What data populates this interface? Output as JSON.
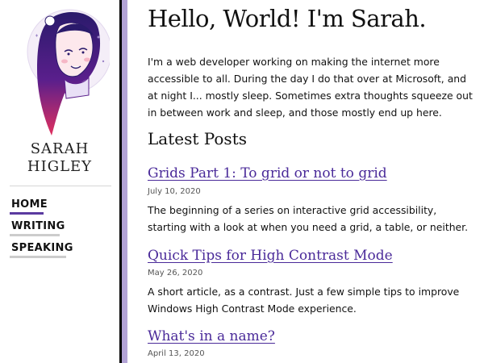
{
  "sidebar": {
    "name_line1": "SARAH",
    "name_line2": "HIGLEY",
    "nav": [
      {
        "label": "HOME",
        "active": true
      },
      {
        "label": "WRITING",
        "active": false
      },
      {
        "label": "SPEAKING",
        "active": false
      }
    ]
  },
  "main": {
    "heading": "Hello, World! I'm Sarah.",
    "intro": "I'm a web developer working on making the internet more accessible to all. During the day I do that over at Microsoft, and at night I... mostly sleep. Sometimes extra thoughts squeeze out in between work and sleep, and those mostly end up here.",
    "latest_heading": "Latest Posts",
    "posts": [
      {
        "title": "Grids Part 1: To grid or not to grid",
        "date": "July 10, 2020",
        "excerpt": "The beginning of a series on interactive grid accessibility, starting with a look at when you need a grid, a table, or neither."
      },
      {
        "title": "Quick Tips for High Contrast Mode",
        "date": "May 26, 2020",
        "excerpt": "A short article, as a contrast. Just a few simple tips to improve Windows High Contrast Mode experience."
      },
      {
        "title": "What's in a name?",
        "date": "April 13, 2020",
        "excerpt": ""
      }
    ]
  },
  "colors": {
    "accent": "#4a2a99",
    "rail": "#b3a3d6",
    "nav_active": "#5b3aa0",
    "nav_inactive": "#cccccc"
  },
  "icons": {
    "avatar": "avatar-illustration"
  }
}
